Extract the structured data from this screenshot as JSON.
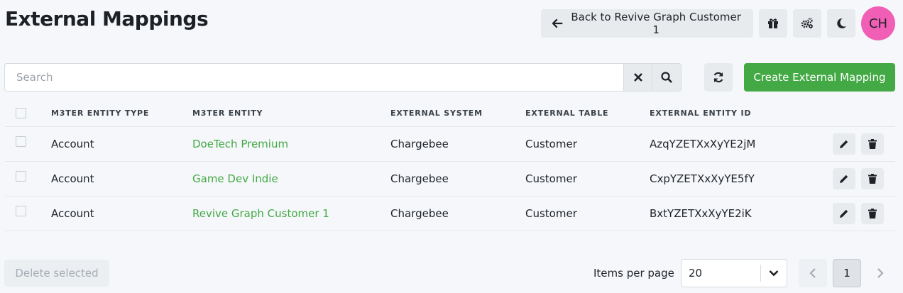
{
  "page": {
    "title": "External Mappings"
  },
  "header": {
    "back_label": "Back to Revive Graph Customer 1",
    "avatar_initials": "CH"
  },
  "search": {
    "placeholder": "Search",
    "value": ""
  },
  "toolbar": {
    "create_label": "Create External Mapping"
  },
  "table": {
    "columns": [
      "M3TER ENTITY TYPE",
      "M3TER ENTITY",
      "EXTERNAL SYSTEM",
      "EXTERNAL TABLE",
      "EXTERNAL ENTITY ID"
    ],
    "rows": [
      {
        "entity_type": "Account",
        "entity": "DoeTech Premium",
        "system": "Chargebee",
        "table": "Customer",
        "external_id": "AzqYZETXxXyYE2jM"
      },
      {
        "entity_type": "Account",
        "entity": "Game Dev Indie",
        "system": "Chargebee",
        "table": "Customer",
        "external_id": "CxpYZETXxXyYE5fY"
      },
      {
        "entity_type": "Account",
        "entity": "Revive Graph Customer 1",
        "system": "Chargebee",
        "table": "Customer",
        "external_id": "BxtYZETXxXyYE2iK"
      }
    ]
  },
  "footer": {
    "delete_label": "Delete selected",
    "items_per_page_label": "Items per page",
    "items_per_page_value": "20",
    "current_page": "1"
  },
  "colors": {
    "accent": "#43a944",
    "avatar": "#f05fb5",
    "background": "#f5f7fa"
  },
  "icons": [
    "arrow-left-icon",
    "gift-icon",
    "cogs-icon",
    "moon-icon",
    "close-icon",
    "search-icon",
    "refresh-icon",
    "pencil-icon",
    "trash-icon",
    "chevron-down-icon",
    "chevron-left-icon",
    "chevron-right-icon"
  ]
}
